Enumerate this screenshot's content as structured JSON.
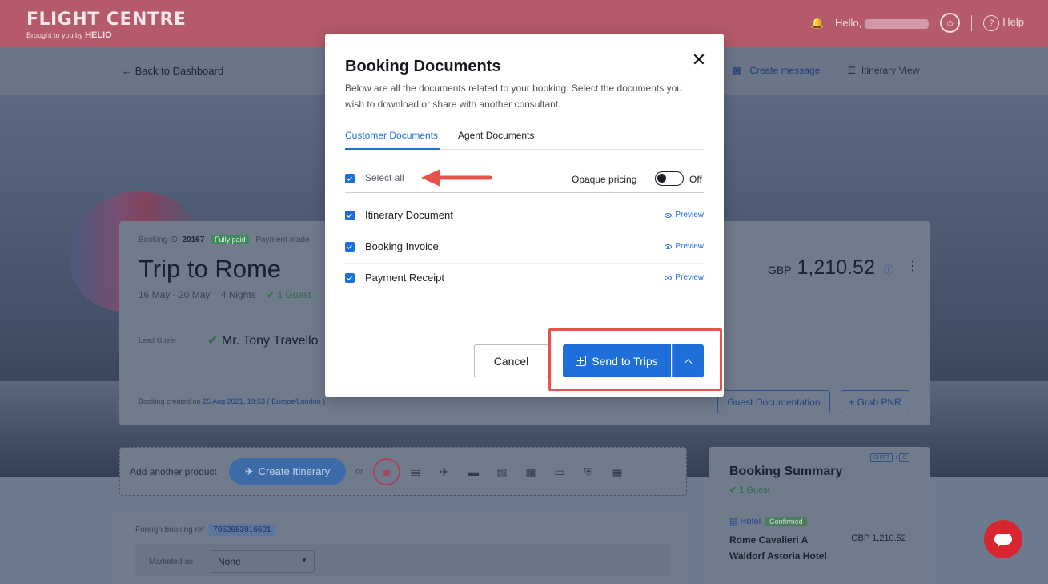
{
  "colors": {
    "accent": "#1e6fd9",
    "brand": "#b45a6a",
    "annotation": "#e5534b"
  },
  "header": {
    "brand": "FLIGHT CENTRE",
    "brand_sub": "Brought to you by",
    "brand_sub_strong": "HELIO",
    "greeting": "Hello,",
    "help": "Help",
    "icons": [
      "bell-icon",
      "user-circle-icon",
      "help-circle-icon"
    ]
  },
  "subnav": {
    "back": "← Back to Dashboard",
    "create_message": "Create message",
    "itinerary_view": "Itinerary View"
  },
  "booking": {
    "id_label": "Booking ID",
    "id": "20167",
    "paid_badge": "Fully paid",
    "payment_label": "Payment made",
    "title": "Trip to Rome",
    "dates": "16 May - 20 May",
    "nights": "4 Nights",
    "guests": "1 Guest",
    "lead_label": "Lead Guest",
    "lead_name": "Mr. Tony Travello",
    "currency": "GBP",
    "price": "1,210.52",
    "created_label": "Booking created on",
    "created_value": "25 Aug 2021, 19:53 ( Europe/London )",
    "guest_doc_btn": "Guest Documentation",
    "grab_pnr_btn": "+ Grab PNR"
  },
  "add_product": {
    "label": "Add another product",
    "create_itinerary": "Create Itinerary",
    "or": "or",
    "product_icons": [
      "suitcase-icon",
      "bed-icon",
      "plane-icon",
      "car-icon",
      "bus-icon",
      "luggage-icon",
      "ticket-icon",
      "shield-icon",
      "grid-icon"
    ]
  },
  "lower": {
    "foreign_ref_label": "Foreign booking ref",
    "foreign_ref": "7962683916601",
    "marketed_label": "Marketed as",
    "marketed_value": "None"
  },
  "summary": {
    "title": "Booking Summary",
    "guests": "1 Guest",
    "shortcut_a": "SHIFT",
    "shortcut_plus": "+",
    "shortcut_b": "C",
    "hotel_label": "Hotel",
    "hotel_status": "Confirmed",
    "hotel_name": "Rome Cavalieri A Waldorf Astoria Hotel",
    "hotel_price": "GBP 1,210.52"
  },
  "modal": {
    "title": "Booking Documents",
    "description": "Below are all the documents related to your booking. Select the documents you wish to download or share with another consultant.",
    "tabs": [
      {
        "label": "Customer Documents",
        "active": true
      },
      {
        "label": "Agent Documents",
        "active": false
      }
    ],
    "select_all": "Select all",
    "opaque_pricing": "Opaque pricing",
    "opaque_state": "Off",
    "documents": [
      {
        "name": "Itinerary Document",
        "checked": true,
        "preview": "Preview"
      },
      {
        "name": "Booking Invoice",
        "checked": true,
        "preview": "Preview"
      },
      {
        "name": "Payment Receipt",
        "checked": true,
        "preview": "Preview"
      }
    ],
    "cancel": "Cancel",
    "send": "Send to Trips"
  }
}
